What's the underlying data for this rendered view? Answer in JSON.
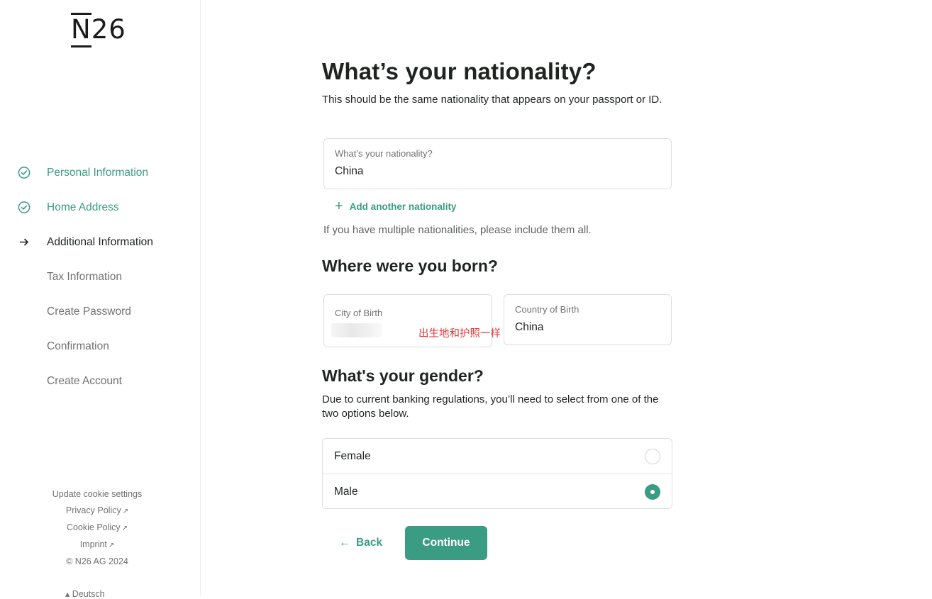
{
  "brand": {
    "logo_text": "26",
    "logo_letter": "N",
    "accent": "#3a9c82"
  },
  "sidebar": {
    "steps": [
      {
        "label": "Personal Information",
        "status": "done",
        "icon": "check-circle-icon"
      },
      {
        "label": "Home Address",
        "status": "done",
        "icon": "check-circle-icon"
      },
      {
        "label": "Additional Information",
        "status": "current",
        "icon": "arrow-right-icon"
      },
      {
        "label": "Tax Information",
        "status": "todo"
      },
      {
        "label": "Create Password",
        "status": "todo"
      },
      {
        "label": "Confirmation",
        "status": "todo"
      },
      {
        "label": "Create Account",
        "status": "todo"
      }
    ],
    "footer": {
      "cookie_settings": "Update cookie settings",
      "privacy_policy": "Privacy Policy",
      "cookie_policy": "Cookie Policy",
      "imprint": "Imprint",
      "copyright": "© N26 AG 2024",
      "language": "Deutsch"
    }
  },
  "nationality": {
    "title": "What’s your nationality?",
    "description": "This should be the same nationality that appears on your passport or ID.",
    "field_label": "What’s your nationality?",
    "field_value": "China",
    "add_label": "Add another nationality",
    "hint": "If you have multiple nationalities, please include them all."
  },
  "birth": {
    "title": "Where were you born?",
    "city_label": "City of Birth",
    "city_annotation": "出生地和护照一样",
    "country_label": "Country of Birth",
    "country_value": "China"
  },
  "gender": {
    "title": "What's your gender?",
    "description": "Due to current banking regulations, you’ll need to select from one of the two options below.",
    "options": [
      {
        "label": "Female",
        "selected": false
      },
      {
        "label": "Male",
        "selected": true
      }
    ]
  },
  "actions": {
    "back_label": "Back",
    "continue_label": "Continue"
  }
}
